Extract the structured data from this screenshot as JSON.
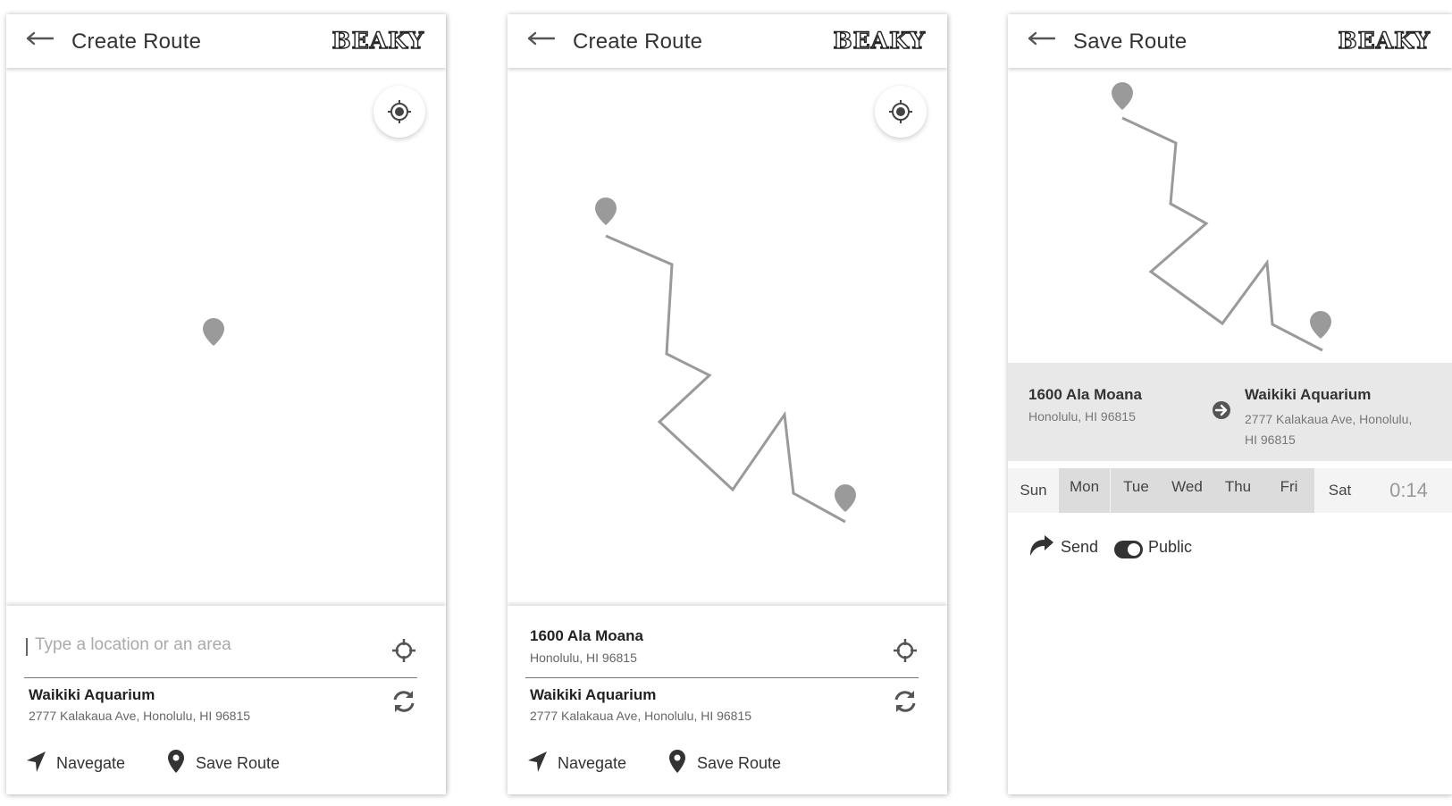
{
  "brand": "BEAKY",
  "colors": {
    "route": "#9a9a9a",
    "pin": "#9a9a9a",
    "icon": "#555555",
    "summary_bg": "#e8e8e8"
  },
  "screens": [
    {
      "title": "Create Route",
      "back_icon": "arrow-left-icon",
      "locate_icon": "locate-target-icon",
      "search": {
        "placeholder": "Type a location or an area",
        "value": ""
      },
      "destination": {
        "name": "Waikiki Aquarium",
        "address": "2777 Kalakaua Ave, Honolulu, HI 96815"
      },
      "actions": {
        "navigate": "Navegate",
        "save": "Save Route"
      }
    },
    {
      "title": "Create Route",
      "back_icon": "arrow-left-icon",
      "locate_icon": "locate-target-icon",
      "origin": {
        "name": "1600 Ala Moana",
        "address": "Honolulu, HI 96815"
      },
      "destination": {
        "name": "Waikiki Aquarium",
        "address": "2777 Kalakaua Ave, Honolulu, HI 96815"
      },
      "actions": {
        "navigate": "Navegate",
        "save": "Save Route"
      }
    },
    {
      "title": "Save Route",
      "back_icon": "arrow-left-icon",
      "summary": {
        "from_name": "1600 Ala Moana",
        "from_address": "Honolulu, HI 96815",
        "to_name": "Waikiki Aquarium",
        "to_address": "2777 Kalakaua Ave, Honolulu, HI 96815"
      },
      "days": [
        {
          "label": "Sun",
          "selected": false
        },
        {
          "label": "Mon",
          "selected": true
        },
        {
          "label": "Tue",
          "selected": true
        },
        {
          "label": "Wed",
          "selected": true
        },
        {
          "label": "Thu",
          "selected": true
        },
        {
          "label": "Fri",
          "selected": true
        },
        {
          "label": "Sat",
          "selected": false
        }
      ],
      "time": "0:14",
      "send_label": "Send",
      "public_label": "Public",
      "public_on": true
    }
  ]
}
